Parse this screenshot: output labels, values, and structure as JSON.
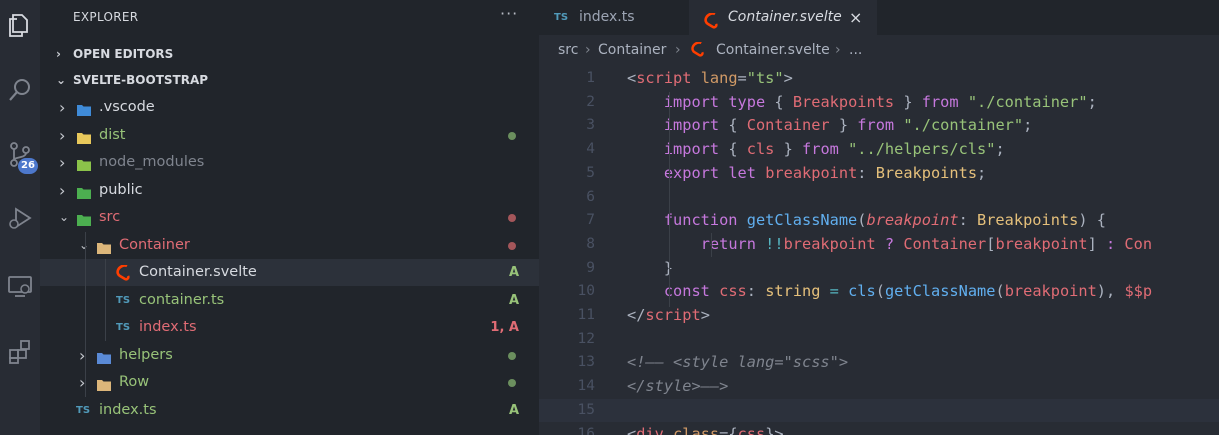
{
  "activity_bar": {
    "icons": [
      "explorer-icon",
      "search-icon",
      "source-control-icon",
      "run-debug-icon",
      "remote-explorer-icon",
      "extensions-icon"
    ],
    "scm_badge": "26"
  },
  "sidebar": {
    "title": "EXPLORER",
    "more": "···",
    "open_editors": "OPEN EDITORS",
    "project": "SVELTE-BOOTSTRAP",
    "tree": [
      {
        "name": ".vscode",
        "kind": "folder",
        "color": "#d7dae0"
      },
      {
        "name": "dist",
        "kind": "folder",
        "color": "#98c379",
        "dot": "#6b8f5e"
      },
      {
        "name": "node_modules",
        "kind": "folder",
        "color": "#7f848e"
      },
      {
        "name": "public",
        "kind": "folder",
        "color": "#d7dae0"
      },
      {
        "name": "src",
        "kind": "folder",
        "color": "#e06c75",
        "dot": "#a4565a"
      },
      {
        "name": "Container",
        "kind": "folder",
        "color": "#e06c75",
        "dot": "#a4565a"
      },
      {
        "name": "Container.svelte",
        "kind": "svelte",
        "color": "#d7dae0",
        "flag": "A",
        "flag_color": "#98c379"
      },
      {
        "name": "container.ts",
        "kind": "ts",
        "color": "#98c379",
        "flag": "A",
        "flag_color": "#98c379"
      },
      {
        "name": "index.ts",
        "kind": "ts",
        "color": "#e06c75",
        "flag": "1, A",
        "flag_color": "#e06c75"
      },
      {
        "name": "helpers",
        "kind": "folder",
        "color": "#98c379",
        "dot": "#6b8f5e"
      },
      {
        "name": "Row",
        "kind": "folder",
        "color": "#98c379",
        "dot": "#6b8f5e"
      },
      {
        "name": "index.ts",
        "kind": "ts",
        "color": "#98c379",
        "flag": "A",
        "flag_color": "#98c379"
      }
    ]
  },
  "tabs": [
    {
      "label": "index.ts",
      "badge": "TS"
    },
    {
      "label": "Container.svelte",
      "close": "×"
    }
  ],
  "breadcrumb": {
    "p1": "src",
    "p2": "Container",
    "p3": "Container.svelte",
    "p4": "..."
  },
  "editor": {
    "lines": [
      {
        "n": "1",
        "tokens": [
          [
            "<",
            "#abb2bf"
          ],
          [
            "script",
            "#e06c75"
          ],
          [
            " ",
            "#abb2bf"
          ],
          [
            "lang",
            "#d19a66"
          ],
          [
            "=",
            "#abb2bf"
          ],
          [
            "\"ts\"",
            "#98c379"
          ],
          [
            ">",
            "#abb2bf"
          ]
        ]
      },
      {
        "n": "2",
        "tokens": [
          [
            "    ",
            ""
          ],
          [
            "import",
            "#c678dd"
          ],
          [
            " ",
            ""
          ],
          [
            "type",
            "#c678dd"
          ],
          [
            " { ",
            "#abb2bf"
          ],
          [
            "Breakpoints",
            "#e06c75"
          ],
          [
            " } ",
            "#abb2bf"
          ],
          [
            "from",
            "#c678dd"
          ],
          [
            " ",
            ""
          ],
          [
            "\"./container\"",
            "#98c379"
          ],
          [
            ";",
            "#abb2bf"
          ]
        ]
      },
      {
        "n": "3",
        "tokens": [
          [
            "    ",
            ""
          ],
          [
            "import",
            "#c678dd"
          ],
          [
            " { ",
            "#abb2bf"
          ],
          [
            "Container",
            "#e06c75"
          ],
          [
            " } ",
            "#abb2bf"
          ],
          [
            "from",
            "#c678dd"
          ],
          [
            " ",
            ""
          ],
          [
            "\"./container\"",
            "#98c379"
          ],
          [
            ";",
            "#abb2bf"
          ]
        ]
      },
      {
        "n": "4",
        "tokens": [
          [
            "    ",
            ""
          ],
          [
            "import",
            "#c678dd"
          ],
          [
            " { ",
            "#abb2bf"
          ],
          [
            "cls",
            "#e06c75"
          ],
          [
            " } ",
            "#abb2bf"
          ],
          [
            "from",
            "#c678dd"
          ],
          [
            " ",
            ""
          ],
          [
            "\"../helpers/cls\"",
            "#98c379"
          ],
          [
            ";",
            "#abb2bf"
          ]
        ]
      },
      {
        "n": "5",
        "tokens": [
          [
            "    ",
            ""
          ],
          [
            "export",
            "#c678dd"
          ],
          [
            " ",
            ""
          ],
          [
            "let",
            "#c678dd"
          ],
          [
            " ",
            ""
          ],
          [
            "breakpoint",
            "#e06c75"
          ],
          [
            ": ",
            "#abb2bf"
          ],
          [
            "Breakpoints",
            "#e5c07b"
          ],
          [
            ";",
            "#abb2bf"
          ]
        ]
      },
      {
        "n": "6",
        "tokens": []
      },
      {
        "n": "7",
        "tokens": [
          [
            "    ",
            ""
          ],
          [
            "function",
            "#c678dd"
          ],
          [
            " ",
            ""
          ],
          [
            "getClassName",
            "#61afef"
          ],
          [
            "(",
            "#abb2bf"
          ],
          [
            "breakpoint",
            "#e06c75",
            "italic"
          ],
          [
            ": ",
            "#abb2bf"
          ],
          [
            "Breakpoints",
            "#e5c07b"
          ],
          [
            ") {",
            "#abb2bf"
          ]
        ]
      },
      {
        "n": "8",
        "tokens": [
          [
            "        ",
            ""
          ],
          [
            "return",
            "#c678dd"
          ],
          [
            " ",
            ""
          ],
          [
            "!!",
            "#56b6c2"
          ],
          [
            "breakpoint",
            "#e06c75"
          ],
          [
            " ? ",
            "#c678dd"
          ],
          [
            "Container",
            "#e06c75"
          ],
          [
            "[",
            "#abb2bf"
          ],
          [
            "breakpoint",
            "#e06c75"
          ],
          [
            "] ",
            "#abb2bf"
          ],
          [
            ": ",
            "#c678dd"
          ],
          [
            "Con",
            "#e06c75"
          ]
        ]
      },
      {
        "n": "9",
        "tokens": [
          [
            "    ",
            ""
          ],
          [
            "}",
            "#abb2bf"
          ]
        ]
      },
      {
        "n": "10",
        "tokens": [
          [
            "    ",
            ""
          ],
          [
            "const",
            "#c678dd"
          ],
          [
            " ",
            ""
          ],
          [
            "css",
            "#e06c75"
          ],
          [
            ": ",
            "#abb2bf"
          ],
          [
            "string",
            "#e5c07b"
          ],
          [
            " = ",
            "#56b6c2"
          ],
          [
            "cls",
            "#61afef"
          ],
          [
            "(",
            "#abb2bf"
          ],
          [
            "getClassName",
            "#61afef"
          ],
          [
            "(",
            "#abb2bf"
          ],
          [
            "breakpoint",
            "#e06c75"
          ],
          [
            "), ",
            "#abb2bf"
          ],
          [
            "$$p",
            "#e06c75"
          ]
        ]
      },
      {
        "n": "11",
        "tokens": [
          [
            "</",
            "#abb2bf"
          ],
          [
            "script",
            "#e06c75"
          ],
          [
            ">",
            "#abb2bf"
          ]
        ]
      },
      {
        "n": "12",
        "tokens": []
      },
      {
        "n": "13",
        "tokens": [
          [
            "<!—— <style lang=\"scss\">",
            "#7f848e",
            "italic"
          ]
        ]
      },
      {
        "n": "14",
        "tokens": [
          [
            "</style>——>",
            "#7f848e",
            "italic"
          ]
        ]
      },
      {
        "n": "15",
        "tokens": []
      },
      {
        "n": "16",
        "tokens": [
          [
            "<",
            "#abb2bf"
          ],
          [
            "div",
            "#e06c75"
          ],
          [
            " ",
            ""
          ],
          [
            "class",
            "#d19a66"
          ],
          [
            "={",
            "#abb2bf"
          ],
          [
            "css",
            "#e06c75"
          ],
          [
            "}>",
            "#abb2bf"
          ]
        ]
      }
    ]
  }
}
